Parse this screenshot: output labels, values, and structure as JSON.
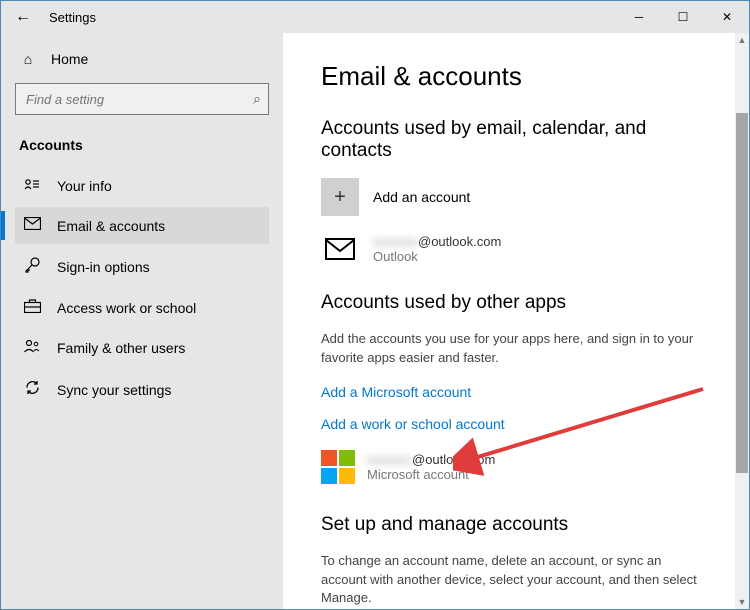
{
  "window": {
    "title": "Settings"
  },
  "sidebar": {
    "home_label": "Home",
    "search_placeholder": "Find a setting",
    "category_label": "Accounts",
    "items": [
      {
        "label": "Your info"
      },
      {
        "label": "Email & accounts"
      },
      {
        "label": "Sign-in options"
      },
      {
        "label": "Access work or school"
      },
      {
        "label": "Family & other users"
      },
      {
        "label": "Sync your settings"
      }
    ]
  },
  "main": {
    "title": "Email & accounts",
    "section1_title": "Accounts used by email, calendar, and contacts",
    "add_account_label": "Add an account",
    "outlook_account": {
      "email_domain": "@outlook.com",
      "provider": "Outlook"
    },
    "section2_title": "Accounts used by other apps",
    "section2_desc": "Add the accounts you use for your apps here, and sign in to your favorite apps easier and faster.",
    "link_add_ms": "Add a Microsoft account",
    "link_add_work": "Add a work or school account",
    "ms_account": {
      "email_domain": "@outlook.com",
      "type_label": "Microsoft account"
    },
    "section3_title": "Set up and manage accounts",
    "section3_desc": "To change an account name, delete an account, or sync an account with another device, select your account, and then select Manage."
  }
}
